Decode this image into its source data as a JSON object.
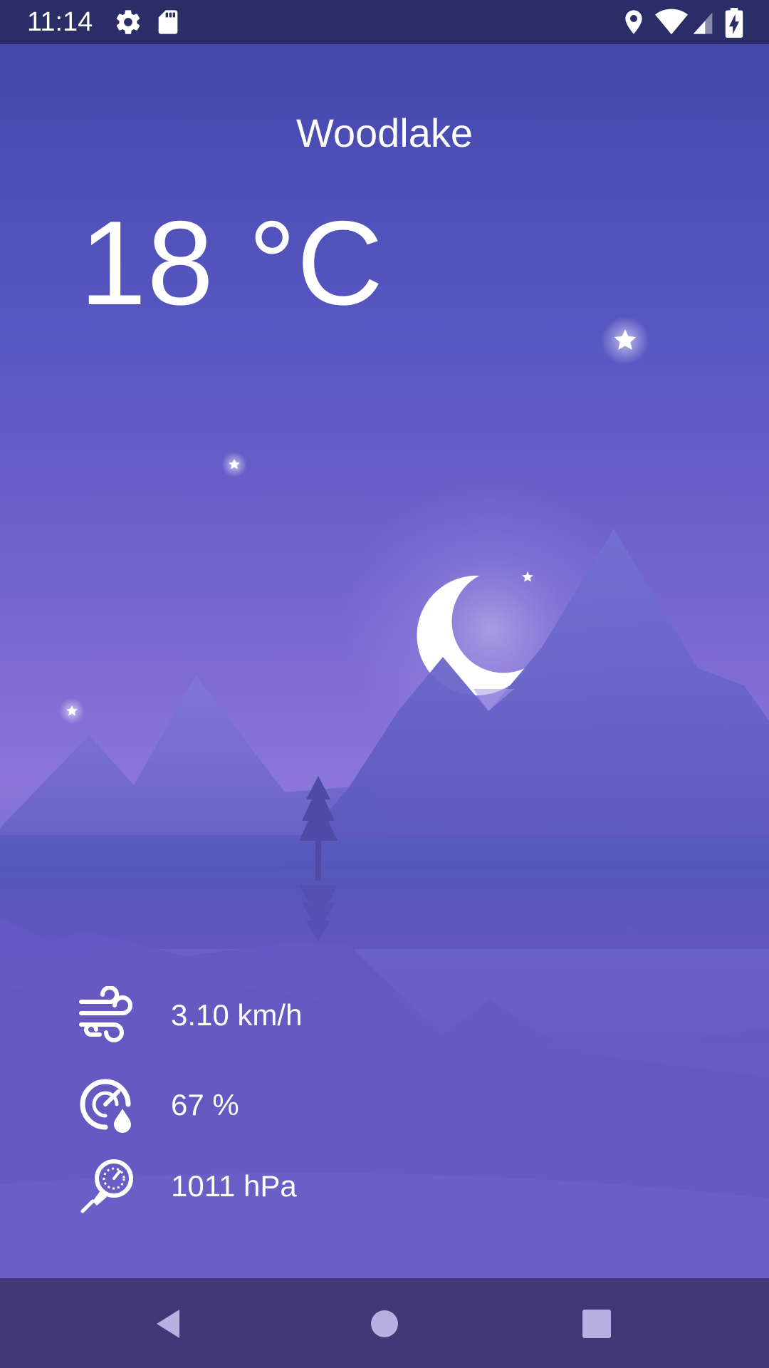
{
  "status_bar": {
    "time": "11:14",
    "icons": [
      "settings-icon",
      "sd-card-icon",
      "location-icon",
      "wifi-icon",
      "cell-signal-icon",
      "battery-charging-icon"
    ]
  },
  "weather": {
    "city": "Woodlake",
    "temperature": "18 °C",
    "wind": "3.10 km/h",
    "humidity": "67 %",
    "pressure": "1011 hPa"
  },
  "metric_icons": [
    "wind-icon",
    "humidity-icon",
    "pressure-icon"
  ],
  "nav_bar": [
    "back-icon",
    "home-icon",
    "recents-icon"
  ],
  "colors": {
    "status_bar": "#2a2d66",
    "nav_bar": "#423878",
    "sky_top": "#4348ab",
    "sky_glow": "#8c76da",
    "text": "#ffffff"
  }
}
